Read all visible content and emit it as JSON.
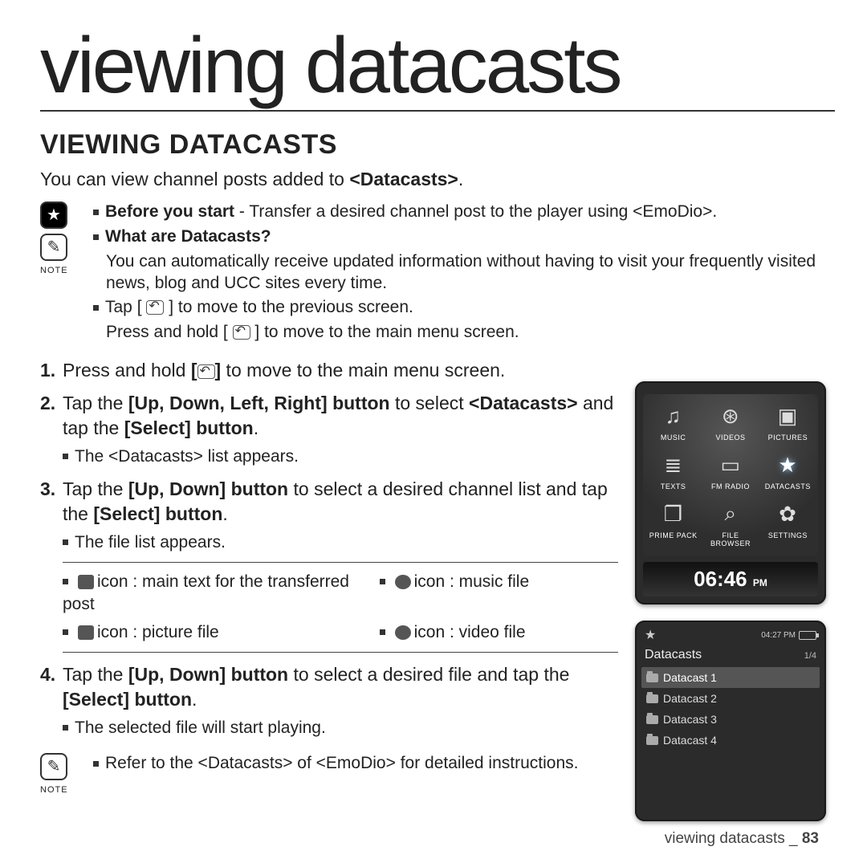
{
  "page": {
    "title": "viewing datacasts",
    "heading": "VIEWING DATACASTS",
    "intro_pre": "You can view channel posts added to ",
    "intro_bold": "<Datacasts>",
    "intro_post": "."
  },
  "note": {
    "label": "NOTE",
    "before_bold": "Before you start",
    "before_rest": " - Transfer a desired channel post to the player using <EmoDio>.",
    "what_heading": "What are Datacasts?",
    "what_body": "You can automatically receive updated information without having to visit your frequently visited news, blog and UCC sites every time.",
    "tap_pre": "Tap [ ",
    "tap_post": " ] to move to the previous screen.",
    "hold_pre": "Press and hold [ ",
    "hold_post": " ] to move to the main menu screen."
  },
  "steps": {
    "s1_a": "Press and hold ",
    "s1_b": "[",
    "s1_c": "]",
    "s1_d": " to move to the main menu screen.",
    "s2_a": "Tap the ",
    "s2_b": "[Up, Down, Left, Right] button",
    "s2_c": " to select ",
    "s2_d": "<Datacasts>",
    "s2_e": " and tap the ",
    "s2_f": "[Select] button",
    "s2_g": ".",
    "s2_sub": "The <Datacasts> list appears.",
    "s3_a": "Tap the ",
    "s3_b": "[Up, Down] button",
    "s3_c": " to select a desired channel list and tap the ",
    "s3_d": "[Select] button",
    "s3_e": ".",
    "s3_sub": "The file list appears.",
    "s4_a": "Tap the ",
    "s4_b": "[Up, Down] button",
    "s4_c": " to select a desired file and tap the ",
    "s4_d": "[Select] button",
    "s4_e": ".",
    "s4_sub": "The selected file will start playing."
  },
  "legend": {
    "text": "icon : main text for the transferred post",
    "music": "icon : music file",
    "picture": "icon : picture file",
    "video": "icon : video file"
  },
  "bottom_note": {
    "label": "NOTE",
    "body": "Refer to the <Datacasts> of <EmoDio> for detailed instructions."
  },
  "footer": {
    "section": "viewing datacasts _",
    "page": " 83"
  },
  "device_menu": {
    "items": [
      {
        "label": "MUSIC",
        "icon": "♫"
      },
      {
        "label": "VIDEOS",
        "icon": "⊛"
      },
      {
        "label": "PICTURES",
        "icon": "▣"
      },
      {
        "label": "TEXTS",
        "icon": "≣"
      },
      {
        "label": "FM RADIO",
        "icon": "▭"
      },
      {
        "label": "DATACASTS",
        "icon": "★",
        "selected": true
      },
      {
        "label": "PRIME PACK",
        "icon": "❐"
      },
      {
        "label": "FILE BROWSER",
        "icon": "⌕"
      },
      {
        "label": "SETTINGS",
        "icon": "✿"
      }
    ],
    "clock_time": "06:46",
    "clock_suffix": "PM"
  },
  "device_list": {
    "status_time": "04:27 PM",
    "title": "Datacasts",
    "pager": "1/4",
    "items": [
      {
        "label": "Datacast 1",
        "selected": true
      },
      {
        "label": "Datacast 2"
      },
      {
        "label": "Datacast 3"
      },
      {
        "label": "Datacast 4"
      }
    ]
  }
}
